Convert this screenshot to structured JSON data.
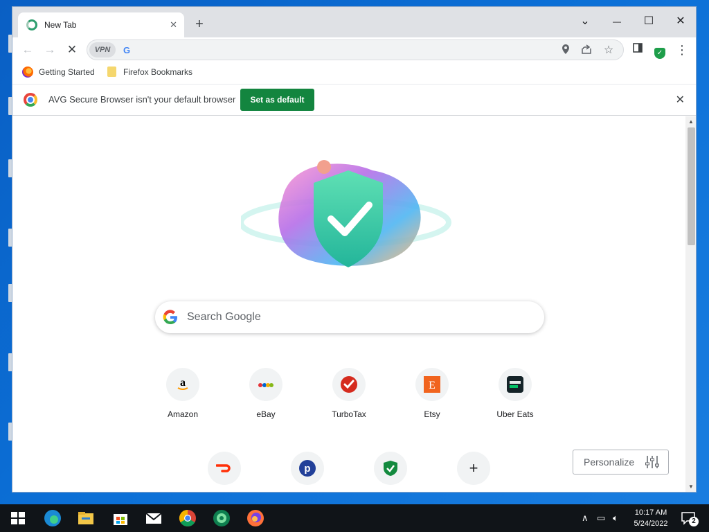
{
  "browser": {
    "tab": {
      "title": "New Tab",
      "close": "✕"
    },
    "new_tab_symbol": "+",
    "window_controls": {
      "tab_search": "⌄",
      "minimize": "—",
      "maximize": "☐",
      "close": "✕"
    },
    "nav": {
      "back": "←",
      "forward": "→",
      "stop": "✕"
    },
    "omnibox": {
      "vpn_label": "VPN",
      "engine_letter": "G",
      "value": ""
    },
    "bookmarks": [
      {
        "label": "Getting Started",
        "icon": "firefox-icon"
      },
      {
        "label": "Firefox Bookmarks",
        "icon": "folder-icon"
      }
    ],
    "infobar": {
      "message": "AVG Secure Browser isn't your default browser",
      "button": "Set as default"
    }
  },
  "newtab": {
    "search_placeholder": "Search Google",
    "shortcuts_row1": [
      {
        "label": "Amazon"
      },
      {
        "label": "eBay"
      },
      {
        "label": "TurboTax"
      },
      {
        "label": "Etsy"
      },
      {
        "label": "Uber Eats"
      }
    ],
    "shortcuts_row2": [
      {
        "icon": "doordash-icon"
      },
      {
        "icon": "pandora-icon"
      },
      {
        "icon": "avg-shield-icon"
      },
      {
        "icon": "add-shortcut-icon"
      }
    ],
    "personalize": "Personalize"
  },
  "taskbar": {
    "clock_time": "10:17 AM",
    "clock_date": "5/24/2022",
    "notification_count": "2"
  },
  "colors": {
    "accent_green": "#13853f",
    "desktop_blue": "#0b6fd6",
    "taskbar": "#101418"
  }
}
